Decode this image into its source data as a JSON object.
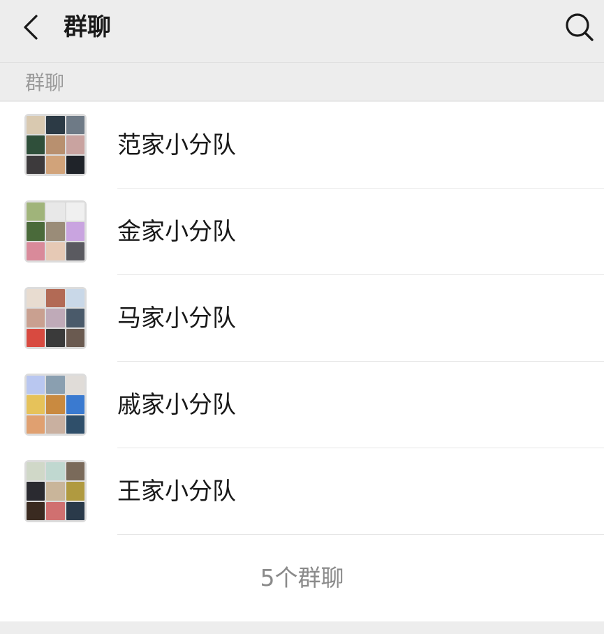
{
  "header": {
    "title": "群聊",
    "back_icon": "chevron-left-icon",
    "search_icon": "search-icon"
  },
  "section": {
    "label": "群聊"
  },
  "groups": [
    {
      "name": "范家小分队",
      "avatar_colors": [
        "#d9c9b0",
        "#2c3a45",
        "#6e7a86",
        "#2f4f3a",
        "#b8906f",
        "#c9a3a0",
        "#3d3a3c",
        "#d1a37a",
        "#1f2329"
      ]
    },
    {
      "name": "金家小分队",
      "avatar_colors": [
        "#a0b47a",
        "#e8e8e8",
        "#f0f0f0",
        "#4a6a3a",
        "#9a8c78",
        "#c9a4e0",
        "#d98a9a",
        "#e6c9b5",
        "#5a5a60"
      ]
    },
    {
      "name": "马家小分队",
      "avatar_colors": [
        "#e8dcd0",
        "#b26a55",
        "#c9d8e8",
        "#c9a090",
        "#bfaab8",
        "#4a5a6a",
        "#d84a40",
        "#3a3a3a",
        "#6a5a50"
      ]
    },
    {
      "name": "戚家小分队",
      "avatar_colors": [
        "#b9c7f0",
        "#8a9fb0",
        "#e0dcd8",
        "#e6c25a",
        "#c98a40",
        "#3a7ad0",
        "#e0a070",
        "#c9b0a0",
        "#2f4f6a"
      ]
    },
    {
      "name": "王家小分队",
      "avatar_colors": [
        "#d0d8c8",
        "#c0d8d0",
        "#7a6a5a",
        "#2a2a30",
        "#c9b59a",
        "#b09a40",
        "#3a2a20",
        "#d07070",
        "#2a3a4a"
      ]
    }
  ],
  "footer": {
    "count_text": "5个群聊"
  }
}
